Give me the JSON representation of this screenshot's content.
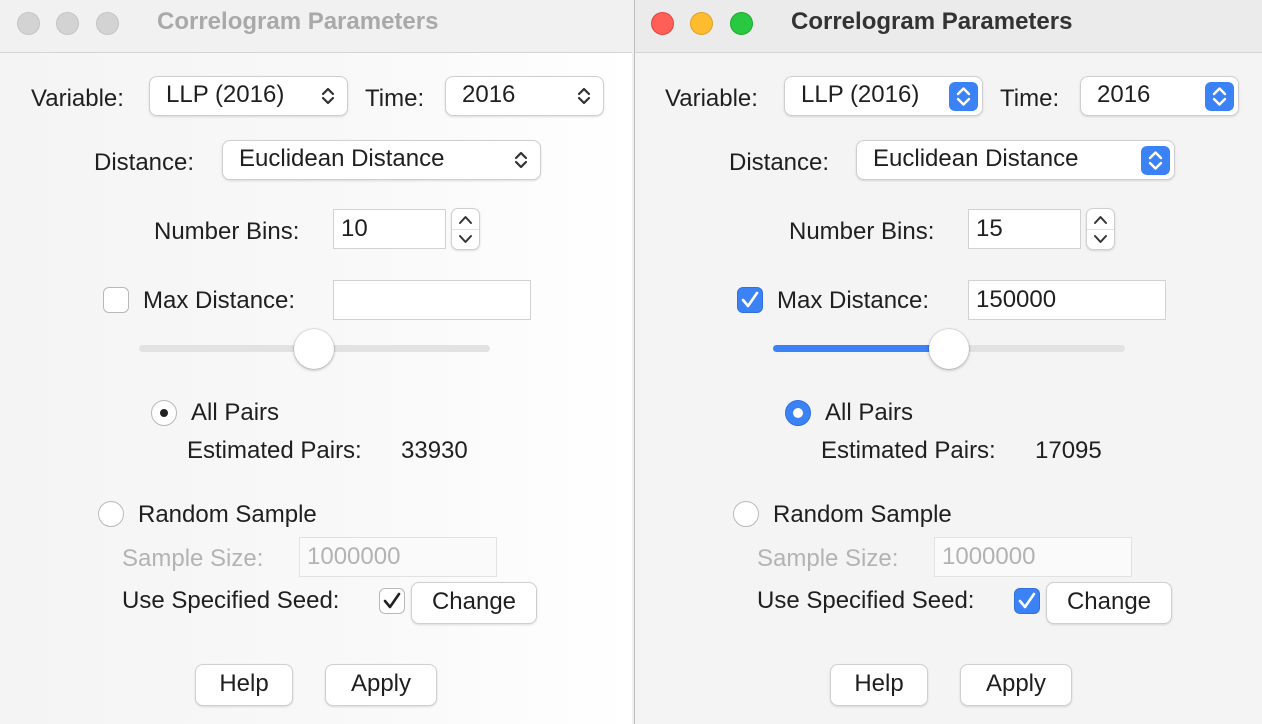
{
  "left_window": {
    "title": "Correlogram Parameters",
    "variable_label": "Variable:",
    "variable_value": "LLP (2016)",
    "time_label": "Time:",
    "time_value": "2016",
    "distance_label": "Distance:",
    "distance_value": "Euclidean Distance",
    "bins_label": "Number Bins:",
    "bins_value": "10",
    "max_distance_label": "Max Distance:",
    "max_distance_checked": false,
    "max_distance_value": "",
    "max_distance_slider_fraction": 0.5,
    "all_pairs_label": "All Pairs",
    "all_pairs_selected": true,
    "estimated_pairs_label": "Estimated Pairs:",
    "estimated_pairs_value": "33930",
    "random_sample_label": "Random Sample",
    "random_sample_selected": false,
    "sample_size_label": "Sample Size:",
    "sample_size_value": "1000000",
    "seed_label": "Use Specified Seed:",
    "seed_checked": true,
    "change_label": "Change",
    "help_label": "Help",
    "apply_label": "Apply"
  },
  "right_window": {
    "title": "Correlogram Parameters",
    "variable_label": "Variable:",
    "variable_value": "LLP (2016)",
    "time_label": "Time:",
    "time_value": "2016",
    "distance_label": "Distance:",
    "distance_value": "Euclidean Distance",
    "bins_label": "Number Bins:",
    "bins_value": "15",
    "max_distance_label": "Max Distance:",
    "max_distance_checked": true,
    "max_distance_value": "150000",
    "max_distance_slider_fraction": 0.5,
    "all_pairs_label": "All Pairs",
    "all_pairs_selected": true,
    "estimated_pairs_label": "Estimated Pairs:",
    "estimated_pairs_value": "17095",
    "random_sample_label": "Random Sample",
    "random_sample_selected": false,
    "sample_size_label": "Sample Size:",
    "sample_size_value": "1000000",
    "seed_label": "Use Specified Seed:",
    "seed_checked": true,
    "change_label": "Change",
    "help_label": "Help",
    "apply_label": "Apply"
  },
  "colors": {
    "accent": "#3b82f6",
    "close": "#ff5f57",
    "minimize": "#febc2e",
    "zoom": "#28c840"
  }
}
